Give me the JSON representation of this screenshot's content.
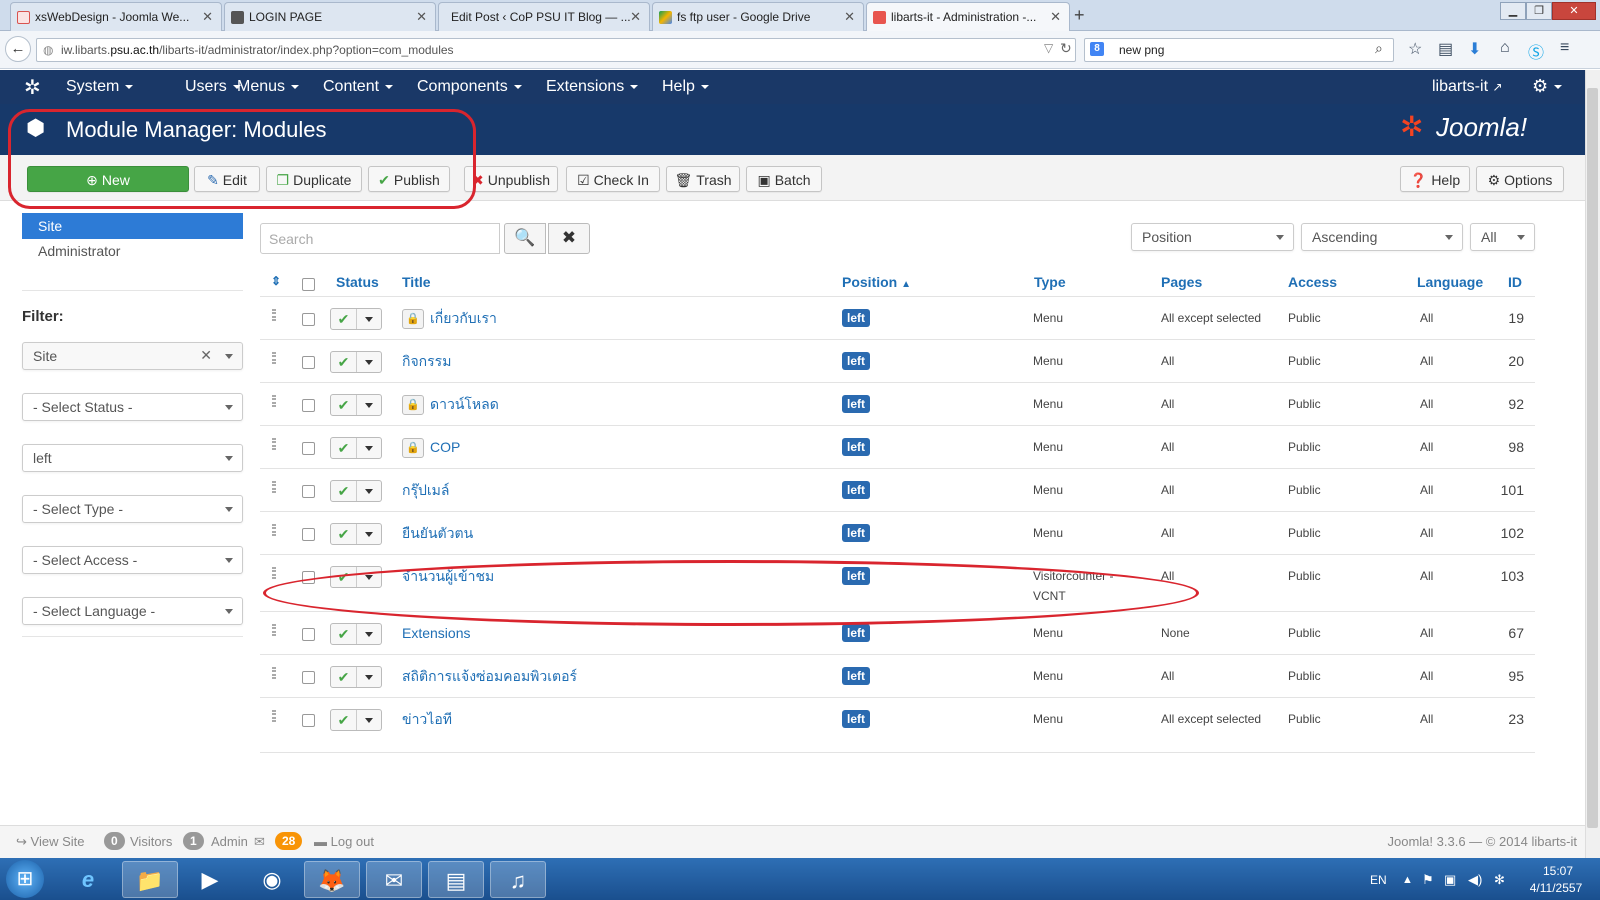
{
  "browser": {
    "tabs": [
      {
        "label": "xsWebDesign - Joomla We...",
        "fav_color": "#d9534f"
      },
      {
        "label": "LOGIN PAGE",
        "fav_color": "#555555"
      },
      {
        "label": "Edit Post ‹ CoP PSU IT Blog — ...",
        "fav_color": "#ffffff"
      },
      {
        "label": "fs ftp user - Google Drive",
        "fav_color": "#f4b400"
      },
      {
        "label": "libarts-it - Administration -...",
        "fav_color": "#e8554e"
      }
    ],
    "url_pre": "iw.libarts.",
    "url_domain": "psu.ac.th",
    "url_post": "/libarts-it/administrator/index.php?option=com_modules",
    "search_value": "new png"
  },
  "joomla_bar": {
    "menus": [
      "System",
      "Users",
      "Menus",
      "Content",
      "Components",
      "Extensions",
      "Help"
    ],
    "site_name": "libarts-it"
  },
  "header": {
    "title": "Module Manager: Modules",
    "logo_text": "Joomla!"
  },
  "toolbar": {
    "new": "New",
    "edit": "Edit",
    "duplicate": "Duplicate",
    "publish": "Publish",
    "unpublish": "Unpublish",
    "checkin": "Check In",
    "trash": "Trash",
    "batch": "Batch",
    "help": "Help",
    "options": "Options"
  },
  "sidebar": {
    "items": [
      "Site",
      "Administrator"
    ],
    "filter_label": "Filter:",
    "filters": [
      "Site",
      "- Select Status -",
      "left",
      "- Select Type -",
      "- Select Access -",
      "- Select Language -"
    ]
  },
  "search": {
    "placeholder": "Search",
    "sort_position": "Position",
    "sort_order": "Ascending",
    "limit": "All"
  },
  "table": {
    "headers": {
      "status": "Status",
      "title": "Title",
      "position": "Position",
      "type": "Type",
      "pages": "Pages",
      "access": "Access",
      "language": "Language",
      "id": "ID"
    },
    "rows": [
      {
        "title": "เกี่ยวกับเรา",
        "locked": true,
        "position": "left",
        "type": "Menu",
        "pages": "All except selected",
        "access": "Public",
        "language": "All",
        "id": "19"
      },
      {
        "title": "กิจกรรม",
        "locked": false,
        "position": "left",
        "type": "Menu",
        "pages": "All",
        "access": "Public",
        "language": "All",
        "id": "20"
      },
      {
        "title": "ดาวน์โหลด",
        "locked": true,
        "position": "left",
        "type": "Menu",
        "pages": "All",
        "access": "Public",
        "language": "All",
        "id": "92"
      },
      {
        "title": "COP",
        "locked": true,
        "position": "left",
        "type": "Menu",
        "pages": "All",
        "access": "Public",
        "language": "All",
        "id": "98"
      },
      {
        "title": "กรุ๊ปเมล์",
        "locked": false,
        "position": "left",
        "type": "Menu",
        "pages": "All",
        "access": "Public",
        "language": "All",
        "id": "101"
      },
      {
        "title": "ยืนยันตัวตน",
        "locked": false,
        "position": "left",
        "type": "Menu",
        "pages": "All",
        "access": "Public",
        "language": "All",
        "id": "102"
      },
      {
        "title": "จำนวนผู้เข้าชม",
        "locked": false,
        "position": "left",
        "type": "Visitorcounter - VCNT",
        "type_line1": "Visitorcounter -",
        "type_line2": "VCNT",
        "pages": "All",
        "access": "Public",
        "language": "All",
        "id": "103"
      },
      {
        "title": "Extensions",
        "locked": false,
        "position": "left",
        "type": "Menu",
        "pages": "None",
        "access": "Public",
        "language": "All",
        "id": "67"
      },
      {
        "title": "สถิติการแจ้งซ่อมคอมพิวเตอร์",
        "locked": false,
        "position": "left",
        "type": "Menu",
        "pages": "All",
        "access": "Public",
        "language": "All",
        "id": "95"
      },
      {
        "title": "ข่าวไอที",
        "locked": false,
        "position": "left",
        "type": "Menu",
        "pages": "All except selected",
        "access": "Public",
        "language": "All",
        "id": "23"
      }
    ]
  },
  "footer": {
    "view_site": "View Site",
    "visitors_count": "0",
    "visitors": "Visitors",
    "admin_count": "1",
    "admin": "Admin",
    "messages_count": "28",
    "logout": "Log out",
    "version": "Joomla! 3.3.6  —  © 2014 libarts-it"
  },
  "taskbar": {
    "lang": "EN",
    "time": "15:07",
    "date": "4/11/2557"
  },
  "colors": {
    "annotation": "#d9252e",
    "joomla_blue": "#1a3867",
    "link_blue": "#1f6fb5",
    "new_green": "#46a546"
  }
}
